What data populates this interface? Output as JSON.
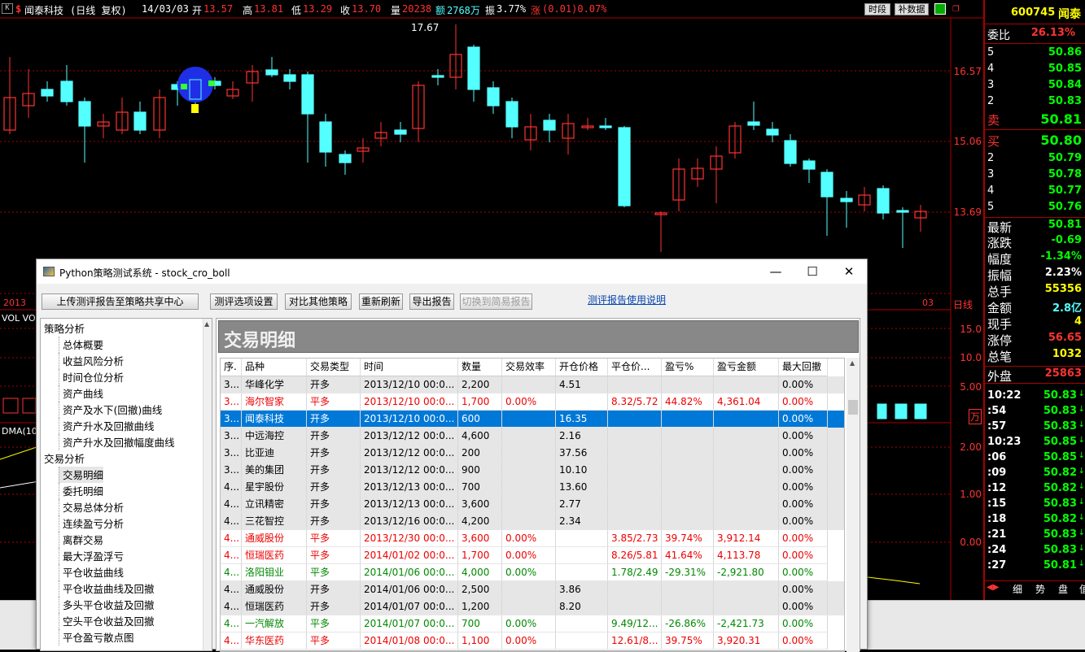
{
  "topbar": {
    "k": "K",
    "s": "$",
    "name": "闻泰科技",
    "period": "(日线 复权)",
    "date": "14/03/03",
    "open_l": "开",
    "open": "13.57",
    "high_l": "高",
    "high": "13.81",
    "low_l": "低",
    "low": "13.29",
    "close_l": "收",
    "close": "13.70",
    "vol_l": "量",
    "vol": "20238",
    "amt_l": "额",
    "amt": "2768万",
    "amp_l": "振",
    "amp": "3.77%",
    "chg_l": "涨",
    "chg": "(0.01)0.07%",
    "btn1": "时段",
    "btn2": "补数据"
  },
  "axis": {
    "p1": "16.57",
    "p2": "15.06",
    "p3": "13.69",
    "v1": "15.0",
    "v2": "10.0",
    "v3": "5.00",
    "unit": "万",
    "d1": "2.00",
    "d2": "1.00",
    "d3": "0.00"
  },
  "chart_labels": {
    "peak": "17.67",
    "vol": "VOL VO",
    "dma": "DMA(10",
    "y2013": "2013",
    "y03": "03",
    "rix": "日线"
  },
  "side": {
    "code": "600745",
    "name": "闻泰",
    "wb_l": "委比",
    "wb": "26.13%",
    "sells": [
      {
        "l": "5",
        "v": "50.86"
      },
      {
        "l": "4",
        "v": "50.85"
      },
      {
        "l": "3",
        "v": "50.84"
      },
      {
        "l": "2",
        "v": "50.83"
      }
    ],
    "sell1_l": "卖",
    "sell1": "50.81",
    "buy1_l": "买",
    "buy1": "50.80",
    "buys": [
      {
        "l": "2",
        "v": "50.79"
      },
      {
        "l": "3",
        "v": "50.78"
      },
      {
        "l": "4",
        "v": "50.77"
      },
      {
        "l": "5",
        "v": "50.76"
      }
    ],
    "stats": [
      {
        "l": "最新",
        "v": "50.81"
      },
      {
        "l": "涨跌",
        "v": "-0.69"
      },
      {
        "l": "幅度",
        "v": "-1.34%"
      },
      {
        "l": "振幅",
        "v": "2.23%"
      },
      {
        "l": "总手",
        "v": "55356"
      },
      {
        "l": "金额",
        "v": "2.8亿"
      },
      {
        "l": "现手",
        "v": "4"
      },
      {
        "l": "涨停",
        "v": "56.65"
      },
      {
        "l": "总笔",
        "v": "1032"
      }
    ],
    "wp_l": "外盘",
    "wp": "25863",
    "ticks": [
      {
        "t": "10:22",
        "p": "50.83"
      },
      {
        "t": ":54",
        "p": "50.83"
      },
      {
        "t": ":57",
        "p": "50.83"
      },
      {
        "t": "10:23",
        "p": "50.85"
      },
      {
        "t": ":06",
        "p": "50.85"
      },
      {
        "t": ":09",
        "p": "50.82"
      },
      {
        "t": ":12",
        "p": "50.82"
      },
      {
        "t": ":15",
        "p": "50.83"
      },
      {
        "t": ":18",
        "p": "50.82"
      },
      {
        "t": ":21",
        "p": "50.83"
      },
      {
        "t": ":24",
        "p": "50.83"
      },
      {
        "t": ":27",
        "p": "50.81"
      }
    ],
    "tabs": [
      "细",
      "势",
      "盘",
      "值"
    ]
  },
  "window": {
    "title": "Python策略测试系统 - stock_cro_boll",
    "toolbar": {
      "upload": "上传测评报告至策略共享中心",
      "options": "测评选项设置",
      "compare": "对比其他策略",
      "refresh": "重新刷新",
      "export": "导出报告",
      "simple": "切换到简易报告",
      "help": "测评报告使用说明"
    },
    "tree": [
      {
        "t": "策略分析",
        "lvl": 0
      },
      {
        "t": "总体概要",
        "lvl": 1
      },
      {
        "t": "收益风险分析",
        "lvl": 1
      },
      {
        "t": "时间仓位分析",
        "lvl": 1
      },
      {
        "t": "资产曲线",
        "lvl": 1
      },
      {
        "t": "资产及水下(回撤)曲线",
        "lvl": 1
      },
      {
        "t": "资产升水及回撤曲线",
        "lvl": 1
      },
      {
        "t": "资产升水及回撤幅度曲线",
        "lvl": 1
      },
      {
        "t": "交易分析",
        "lvl": 0
      },
      {
        "t": "交易明细",
        "lvl": 1
      },
      {
        "t": "委托明细",
        "lvl": 1
      },
      {
        "t": "交易总体分析",
        "lvl": 1
      },
      {
        "t": "连续盈亏分析",
        "lvl": 1
      },
      {
        "t": "离群交易",
        "lvl": 1
      },
      {
        "t": "最大浮盈浮亏",
        "lvl": 1
      },
      {
        "t": "平仓收益曲线",
        "lvl": 1
      },
      {
        "t": "平仓收益曲线及回撤",
        "lvl": 1
      },
      {
        "t": "多头平仓收益及回撤",
        "lvl": 1
      },
      {
        "t": "空头平仓收益及回撤",
        "lvl": 1
      },
      {
        "t": "平仓盈亏散点图",
        "lvl": 1
      }
    ],
    "section": "交易明细",
    "columns": [
      "序.",
      "品种",
      "交易类型",
      "时间",
      "数量",
      "交易效率",
      "开仓价格",
      "平仓价...",
      "盈亏%",
      "盈亏金额",
      "最大回撤"
    ],
    "rows": [
      [
        "3...",
        "华峰化学",
        "开多",
        "2013/12/10 00:0...",
        "2,200",
        "",
        "4.51",
        "",
        "",
        "",
        "0.00%",
        "open"
      ],
      [
        "3...",
        "海尔智家",
        "平多",
        "2013/12/10 00:0...",
        "1,700",
        "0.00%",
        "",
        "8.32/5.72",
        "44.82%",
        "4,361.04",
        "0.00%",
        "red"
      ],
      [
        "3...",
        "闻泰科技",
        "开多",
        "2013/12/10 00:0...",
        "600",
        "",
        "16.35",
        "",
        "",
        "",
        "0.00%",
        "sel"
      ],
      [
        "3...",
        "中远海控",
        "开多",
        "2013/12/12 00:0...",
        "4,600",
        "",
        "2.16",
        "",
        "",
        "",
        "0.00%",
        "open"
      ],
      [
        "3...",
        "比亚迪",
        "开多",
        "2013/12/12 00:0...",
        "200",
        "",
        "37.56",
        "",
        "",
        "",
        "0.00%",
        "open"
      ],
      [
        "3...",
        "美的集团",
        "开多",
        "2013/12/12 00:0...",
        "900",
        "",
        "10.10",
        "",
        "",
        "",
        "0.00%",
        "open"
      ],
      [
        "4...",
        "星宇股份",
        "开多",
        "2013/12/13 00:0...",
        "700",
        "",
        "13.60",
        "",
        "",
        "",
        "0.00%",
        "open"
      ],
      [
        "4...",
        "立讯精密",
        "开多",
        "2013/12/13 00:0...",
        "3,600",
        "",
        "2.77",
        "",
        "",
        "",
        "0.00%",
        "open"
      ],
      [
        "4...",
        "三花智控",
        "开多",
        "2013/12/16 00:0...",
        "4,200",
        "",
        "2.34",
        "",
        "",
        "",
        "0.00%",
        "open"
      ],
      [
        "4...",
        "通威股份",
        "平多",
        "2013/12/30 00:0...",
        "3,600",
        "0.00%",
        "",
        "3.85/2.73",
        "39.74%",
        "3,912.14",
        "0.00%",
        "red"
      ],
      [
        "4...",
        "恒瑞医药",
        "平多",
        "2014/01/02 00:0...",
        "1,700",
        "0.00%",
        "",
        "8.26/5.81",
        "41.64%",
        "4,113.78",
        "0.00%",
        "red"
      ],
      [
        "4...",
        "洛阳钼业",
        "平多",
        "2014/01/06 00:0...",
        "4,000",
        "0.00%",
        "",
        "1.78/2.49",
        "-29.31%",
        "-2,921.80",
        "0.00%",
        "green"
      ],
      [
        "4...",
        "通威股份",
        "开多",
        "2014/01/06 00:0...",
        "2,500",
        "",
        "3.86",
        "",
        "",
        "",
        "0.00%",
        "open"
      ],
      [
        "4...",
        "恒瑞医药",
        "开多",
        "2014/01/07 00:0...",
        "1,200",
        "",
        "8.20",
        "",
        "",
        "",
        "0.00%",
        "open"
      ],
      [
        "4...",
        "一汽解放",
        "平多",
        "2014/01/07 00:0...",
        "700",
        "0.00%",
        "",
        "9.49/12...",
        "-26.86%",
        "-2,421.73",
        "0.00%",
        "green"
      ],
      [
        "4...",
        "华东医药",
        "平多",
        "2014/01/08 00:0...",
        "1,100",
        "0.00%",
        "",
        "12.61/8...",
        "39.75%",
        "3,920.31",
        "0.00%",
        "red"
      ]
    ]
  },
  "colors": {
    "up": "#ff3232",
    "down": "#54ffff",
    "select": "#0078d7",
    "panelred": "#a00000"
  }
}
